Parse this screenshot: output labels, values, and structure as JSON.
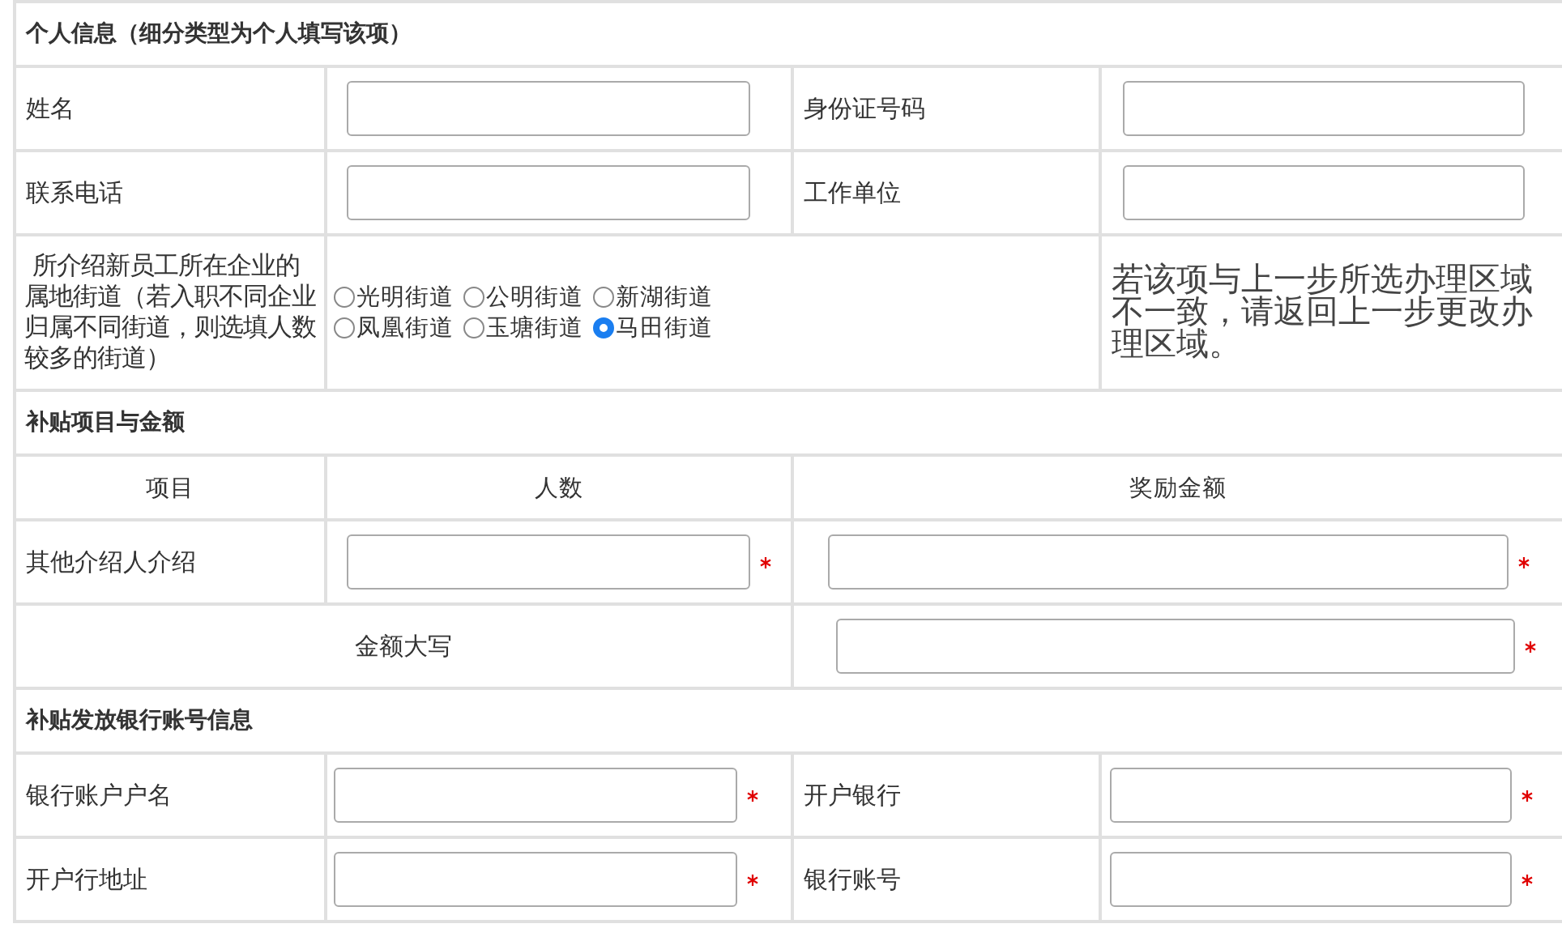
{
  "personal": {
    "title": "个人信息（细分类型为个人填写该项）",
    "rows": [
      [
        {
          "label": "姓名"
        },
        {
          "label": "身份证号码"
        }
      ],
      [
        {
          "label": "联系电话"
        },
        {
          "label": "工作单位"
        }
      ]
    ],
    "street": {
      "label": " 所介绍新员工所在企业的属地街道（若入职不同企业归属不同街道，则选填人数较多的街道）",
      "options": [
        {
          "label": "光明街道",
          "selected": false
        },
        {
          "label": "公明街道",
          "selected": false
        },
        {
          "label": "新湖街道",
          "selected": false
        },
        {
          "label": "凤凰街道",
          "selected": false
        },
        {
          "label": "玉塘街道",
          "selected": false
        },
        {
          "label": "马田街道",
          "selected": true
        }
      ],
      "note": "若该项与上一步所选办理区域不一致，请返回上一步更改办理区域。"
    }
  },
  "subsidy": {
    "title": "补贴项目与金额",
    "columns": [
      "项目",
      "人数",
      "奖励金额"
    ],
    "rows": [
      {
        "label": "其他介绍人介绍",
        "required": true
      }
    ],
    "amount_words": {
      "label": "金额大写",
      "required": true
    }
  },
  "bank": {
    "title": "补贴发放银行账号信息",
    "rows": [
      [
        {
          "label": "银行账户户名",
          "required": true
        },
        {
          "label": "开户银行",
          "required": true
        }
      ],
      [
        {
          "label": "开户行地址",
          "required": true
        },
        {
          "label": "银行账号",
          "required": true
        }
      ]
    ]
  }
}
